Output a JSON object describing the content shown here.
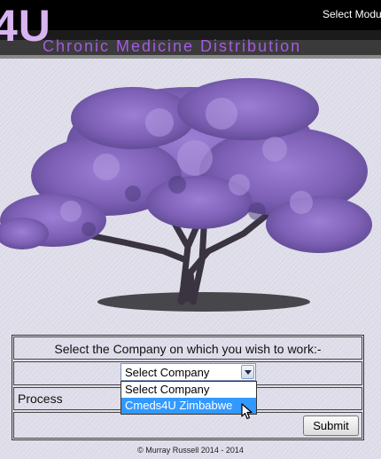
{
  "header": {
    "logo": "4U",
    "subtitle": "Chronic Medicine Distribution",
    "module_link": "Select Modu"
  },
  "form": {
    "title": "Select the Company on which you wish to work:-",
    "company_select": {
      "selected": "Select Company",
      "options": [
        "Select Company",
        "Cmeds4U Zimbabwe"
      ],
      "highlighted_index": 1
    },
    "process_label": "Process",
    "submit_label": "Submit"
  },
  "footer": {
    "copyright": "© Murray Russell 2014 - 2014"
  },
  "colors": {
    "header_bg": "#000000",
    "logo": "#d8b4f0",
    "subtitle": "#a35be0",
    "highlight": "#3399ff",
    "tree_blossom": "#8e6fc4"
  }
}
